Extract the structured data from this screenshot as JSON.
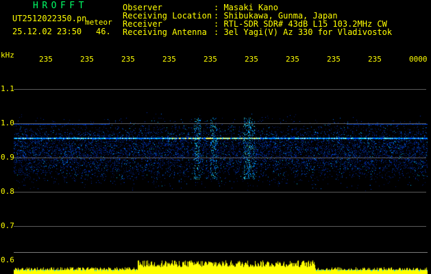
{
  "app": {
    "title": "HROFFT"
  },
  "file": {
    "name": "UT2512022350.pn",
    "suffix": "meteor",
    "datetime": "25.12.02 23:50",
    "count": "46."
  },
  "info": {
    "rows": [
      {
        "label": "Observer",
        "value": ": Masaki Kano"
      },
      {
        "label": "Receiving Location",
        "value": ": Shibukawa, Gunma, Japan"
      },
      {
        "label": "Receiver",
        "value": ": RTL-SDR SDR# 43dB L15 103.2MHz CW"
      },
      {
        "label": "Receiving Antenna",
        "value": ": 3el Yagi(V) Az 330 for Vladivostok"
      }
    ]
  },
  "axis": {
    "unit": "kHz",
    "y_ticks": [
      "1.1",
      "1.0",
      "0.9",
      "0.8",
      "0.7",
      "0.6"
    ],
    "x_ticks": [
      "235",
      "235",
      "235",
      "235",
      "235",
      "235",
      "235",
      "235",
      "235",
      "0000"
    ]
  },
  "colors": {
    "text": "#ffff00",
    "title": "#00ff66",
    "grid": "#5a5a5a",
    "background": "#000000"
  }
}
